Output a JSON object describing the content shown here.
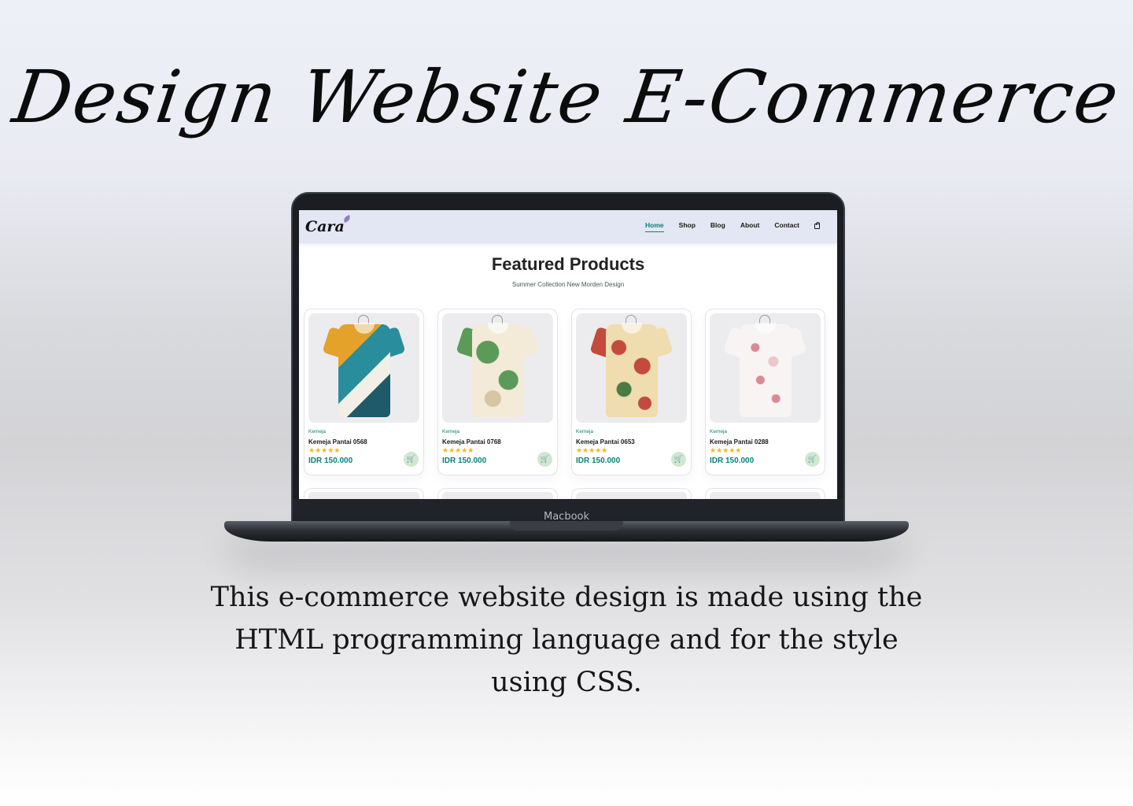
{
  "headline": "Design Website E-Commerce",
  "description": "This e-commerce website design is made using the HTML programming language and for the style using CSS.",
  "device_label": "Macbook",
  "site": {
    "logo": "Cara",
    "nav": [
      "Home",
      "Shop",
      "Blog",
      "About",
      "Contact"
    ],
    "active_nav": "Home",
    "section_title": "Featured Products",
    "section_subtitle": "Summer Collection New Morden Design",
    "products": [
      {
        "brand": "Kemeja",
        "name": "Kemeja Pantai 0568",
        "stars": "★★★★★",
        "price": "IDR 150.000",
        "colors": [
          "#e4a22a",
          "#2a8d9c",
          "#f2f0e6"
        ]
      },
      {
        "brand": "Kemeja",
        "name": "Kemeja Pantai 0768",
        "stars": "★★★★★",
        "price": "IDR 150.000",
        "colors": [
          "#f3ead8",
          "#5c9a5a",
          "#d7c6a2"
        ]
      },
      {
        "brand": "Kemeja",
        "name": "Kemeja Pantai 0653",
        "stars": "★★★★★",
        "price": "IDR 150.000",
        "colors": [
          "#efdcaf",
          "#c44a3c",
          "#4b7a45"
        ]
      },
      {
        "brand": "Kemeja",
        "name": "Kemeja Pantai 0288",
        "stars": "★★★★★",
        "price": "IDR 150.000",
        "colors": [
          "#f8f4f4",
          "#d88a95",
          "#e9c7cb"
        ]
      }
    ]
  },
  "colors": {
    "accent": "#088178",
    "star": "#f3b519",
    "nav_bg": "#e3e6f3"
  },
  "icons": {
    "cart": "shopping-cart-icon",
    "bag": "shopping-bag-icon"
  }
}
